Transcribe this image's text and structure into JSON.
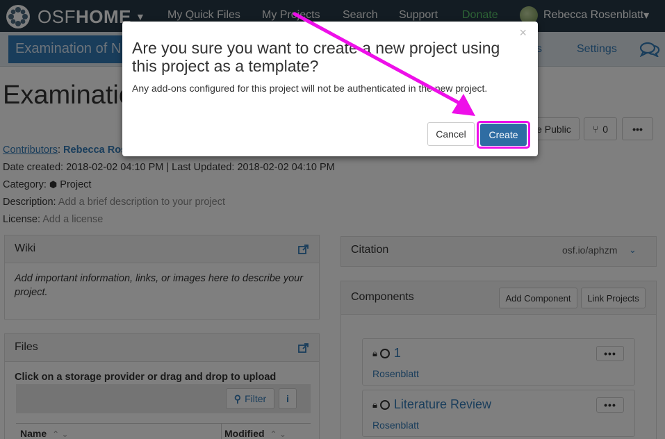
{
  "topnav": {
    "brand_light": "OSF",
    "brand_bold": "HOME",
    "links": [
      "My Quick Files",
      "My Projects",
      "Search",
      "Support",
      "Donate"
    ],
    "user_name": "Rebecca Rosenblatt",
    "user_caret": "▾"
  },
  "subnav": {
    "title": "Examination of N",
    "partial_link": "s",
    "settings": "Settings"
  },
  "project": {
    "title": "Examinatio",
    "contributors_label": "Contributors",
    "contributors_value": "Rebecca Ros",
    "date_line": "Date created: 2018-02-02 04:10 PM | Last Updated: 2018-02-02 04:10 PM",
    "category_label": "Category:",
    "category_value": "Project",
    "description_label": "Description:",
    "description_value": "Add a brief description to your project",
    "license_label": "License:",
    "license_value": "Add a license",
    "make_public_partial": "e Public",
    "fork_count": "0",
    "more": "•••"
  },
  "wiki": {
    "heading": "Wiki",
    "body": "Add important information, links, or images here to describe your project."
  },
  "files": {
    "heading": "Files",
    "instructions": "Click on a storage provider or drag and drop to upload",
    "filter_label": "Filter",
    "info_label": "i",
    "col_name": "Name",
    "col_modified": "Modified"
  },
  "citation": {
    "heading": "Citation",
    "link": "osf.io/aphzm"
  },
  "components": {
    "heading": "Components",
    "add_button": "Add Component",
    "link_button": "Link Projects",
    "items": [
      {
        "title": "1",
        "contributor": "Rosenblatt"
      },
      {
        "title": "Literature Review",
        "contributor": "Rosenblatt"
      }
    ]
  },
  "modal": {
    "close": "×",
    "title": "Are you sure you want to create a new project using this project as a template?",
    "body": "Any add-ons configured for this project will not be authenticated in the new project.",
    "cancel": "Cancel",
    "create": "Create"
  },
  "colors": {
    "nav_bg": "#263947",
    "primary": "#337ab7",
    "create_button": "#2f6da3",
    "highlight": "#ee0fe9",
    "donate": "#5ac66a"
  }
}
